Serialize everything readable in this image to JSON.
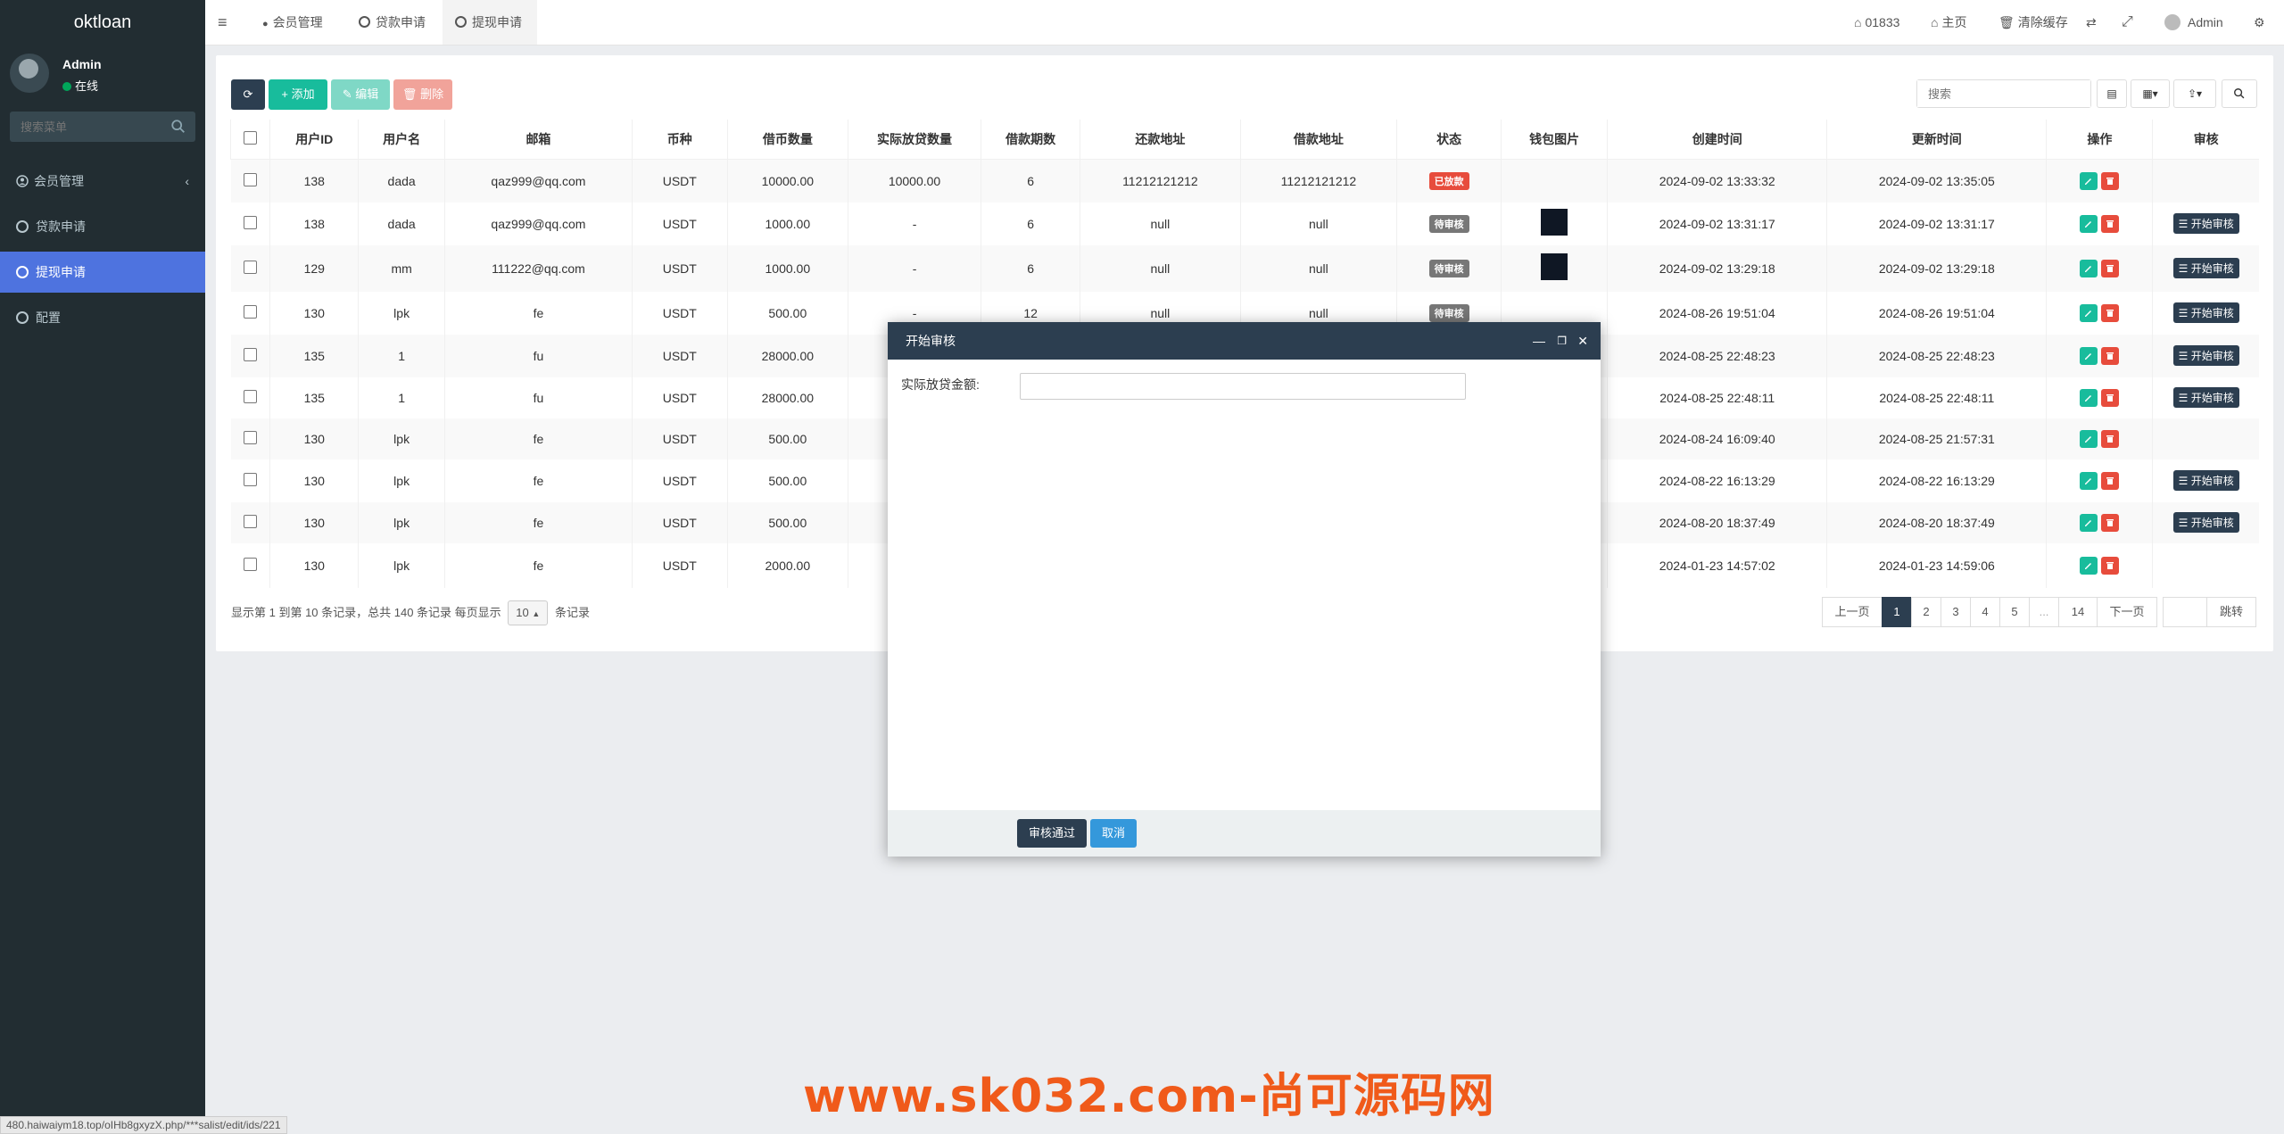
{
  "app": {
    "title": "oktloan",
    "user": "Admin",
    "online": "在线"
  },
  "sidebar": {
    "search_placeholder": "搜索菜单",
    "items": [
      {
        "label": "会员管理"
      },
      {
        "label": "贷款申请"
      },
      {
        "label": "提现申请"
      },
      {
        "label": "配置"
      }
    ]
  },
  "topbar": {
    "tabs": [
      {
        "label": "会员管理"
      },
      {
        "label": "贷款申请"
      },
      {
        "label": "提现申请"
      }
    ],
    "code": "01833",
    "home": "主页",
    "clear_cache": "清除缓存",
    "admin": "Admin"
  },
  "toolbar": {
    "add": "添加",
    "edit": "编辑",
    "delete": "删除",
    "search_placeholder": "搜索"
  },
  "table": {
    "headers": [
      "用户ID",
      "用户名",
      "邮箱",
      "币种",
      "借币数量",
      "实际放贷数量",
      "借款期数",
      "还款地址",
      "借款地址",
      "状态",
      "钱包图片",
      "创建时间",
      "更新时间",
      "操作",
      "审核"
    ],
    "rows": [
      {
        "id": "138",
        "name": "dada",
        "email": "qaz999@qq.com",
        "coin": "USDT",
        "amount": "10000.00",
        "actual": "10000.00",
        "periods": "6",
        "repay": "11212121212",
        "borrow": "11212121212",
        "status": "已放款",
        "created": "2024-09-02 13:33:32",
        "updated": "2024-09-02 13:35:05"
      },
      {
        "id": "138",
        "name": "dada",
        "email": "qaz999@qq.com",
        "coin": "USDT",
        "amount": "1000.00",
        "actual": "-",
        "periods": "6",
        "repay": "null",
        "borrow": "null",
        "status": "待审核",
        "created": "2024-09-02 13:31:17",
        "updated": "2024-09-02 13:31:17"
      },
      {
        "id": "129",
        "name": "mm",
        "email": "111222@qq.com",
        "coin": "USDT",
        "amount": "1000.00",
        "actual": "-",
        "periods": "6",
        "repay": "null",
        "borrow": "null",
        "status": "待审核",
        "created": "2024-09-02 13:29:18",
        "updated": "2024-09-02 13:29:18"
      },
      {
        "id": "130",
        "name": "lpk",
        "email": "fe",
        "coin": "USDT",
        "amount": "500.00",
        "actual": "-",
        "periods": "12",
        "repay": "null",
        "borrow": "null",
        "status": "待审核",
        "created": "2024-08-26 19:51:04",
        "updated": "2024-08-26 19:51:04"
      },
      {
        "id": "135",
        "name": "1",
        "email": "fu",
        "coin": "USDT",
        "amount": "28000.00",
        "actual": "",
        "periods": "",
        "repay": "",
        "borrow": "",
        "status": "",
        "created": "2024-08-25 22:48:23",
        "updated": "2024-08-25 22:48:23"
      },
      {
        "id": "135",
        "name": "1",
        "email": "fu",
        "coin": "USDT",
        "amount": "28000.00",
        "actual": "",
        "periods": "",
        "repay": "",
        "borrow": "",
        "status": "",
        "created": "2024-08-25 22:48:11",
        "updated": "2024-08-25 22:48:11"
      },
      {
        "id": "130",
        "name": "lpk",
        "email": "fe",
        "coin": "USDT",
        "amount": "500.00",
        "actual": "",
        "periods": "",
        "repay": "",
        "borrow": "",
        "status": "",
        "created": "2024-08-24 16:09:40",
        "updated": "2024-08-25 21:57:31"
      },
      {
        "id": "130",
        "name": "lpk",
        "email": "fe",
        "coin": "USDT",
        "amount": "500.00",
        "actual": "",
        "periods": "",
        "repay": "",
        "borrow": "",
        "status": "",
        "created": "2024-08-22 16:13:29",
        "updated": "2024-08-22 16:13:29"
      },
      {
        "id": "130",
        "name": "lpk",
        "email": "fe",
        "coin": "USDT",
        "amount": "500.00",
        "actual": "",
        "periods": "",
        "repay": "",
        "borrow": "",
        "status": "",
        "created": "2024-08-20 18:37:49",
        "updated": "2024-08-20 18:37:49"
      },
      {
        "id": "130",
        "name": "lpk",
        "email": "fe",
        "coin": "USDT",
        "amount": "2000.00",
        "actual": "",
        "periods": "",
        "repay": "",
        "borrow": "",
        "status": "",
        "created": "2024-01-23 14:57:02",
        "updated": "2024-01-23 14:59:06"
      }
    ],
    "audit_label": "开始审核"
  },
  "pagination": {
    "summary": "显示第 1 到第 10 条记录，总共 140 条记录 每页显示",
    "per_page": "10",
    "suffix": "条记录",
    "prev": "上一页",
    "pages": [
      "1",
      "2",
      "3",
      "4",
      "5",
      "...",
      "14"
    ],
    "next": "下一页",
    "jump": "跳转"
  },
  "modal": {
    "title": "开始审核",
    "field_label": "实际放贷金额:",
    "field_value": "",
    "approve": "审核通过",
    "cancel": "取消"
  },
  "status_url": "480.haiwaiym18.top/oIHb8gxyzX.php/***salist/edit/ids/221",
  "watermark": "www.sk032.com-尚可源码网",
  "colors": {
    "sidebar": "#222d32",
    "active": "#4e73df",
    "success": "#18bc9c",
    "danger": "#e74c3c",
    "primary": "#2c3e50",
    "pending": "#777777"
  }
}
